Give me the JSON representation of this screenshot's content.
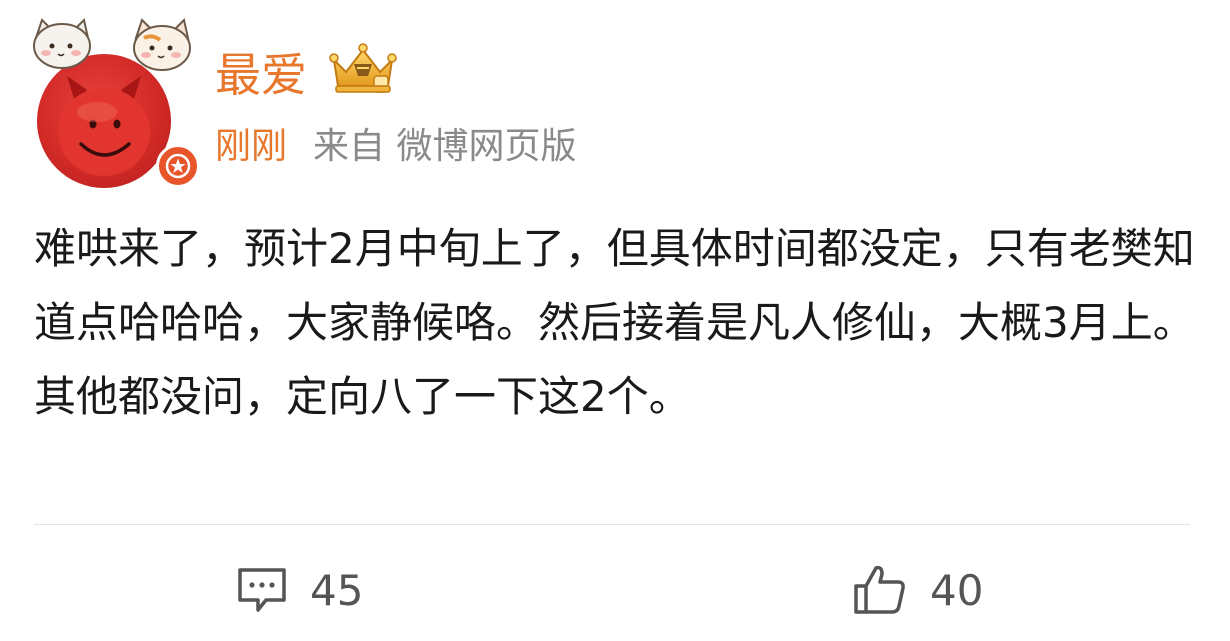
{
  "author": {
    "name": "最爱"
  },
  "meta": {
    "time": "刚刚",
    "source": "来自 微博网页版"
  },
  "content": {
    "paragraphs": [
      "难哄来了，预计2月中旬上了，但具体时间都没定，只有老樊知道点哈哈哈，大家静候咯。然后接着是凡人修仙，大概3月上。",
      "其他都没问，定向八了一下这2个。"
    ]
  },
  "actions": {
    "comment_count": "45",
    "like_count": "40"
  },
  "icons": {
    "avatar": "red-devil-avatar",
    "badge": "verified-star-icon",
    "crown": "vip-crown-icon",
    "comment": "comment-icon",
    "like": "thumbs-up-icon"
  },
  "colors": {
    "accent": "#e8772e",
    "muted": "#8a8a8a",
    "text": "#1a1a1a"
  }
}
